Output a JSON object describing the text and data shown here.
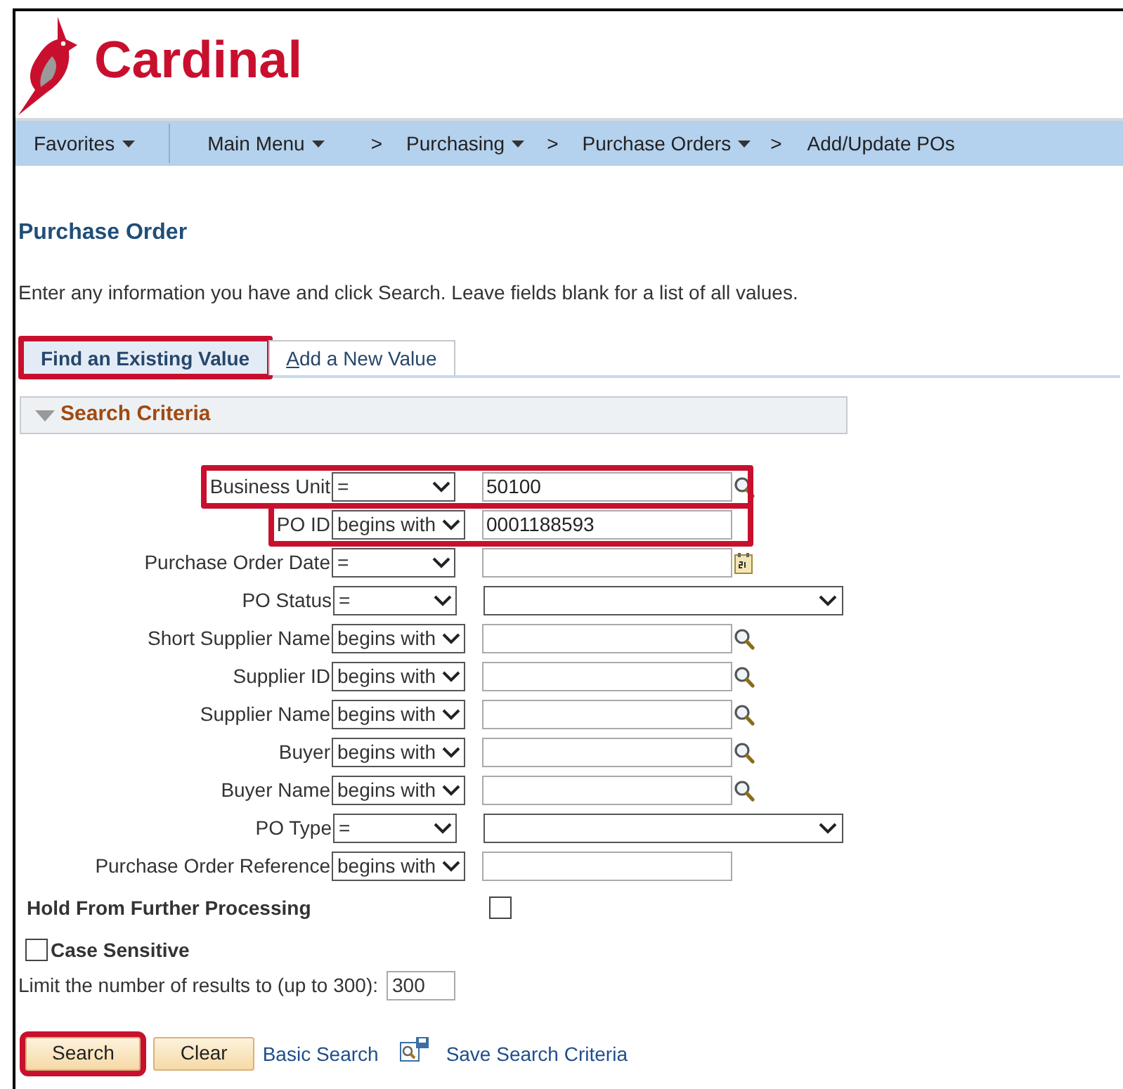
{
  "logo": {
    "text": "Cardinal"
  },
  "nav": [
    {
      "kind": "menu",
      "label": "Favorites",
      "caret": true
    },
    {
      "kind": "menu",
      "label": "Main Menu",
      "caret": true
    },
    {
      "kind": "separator",
      "label": ">"
    },
    {
      "kind": "menu",
      "label": "Purchasing",
      "caret": true
    },
    {
      "kind": "separator",
      "label": ">"
    },
    {
      "kind": "menu",
      "label": "Purchase Orders",
      "caret": true
    },
    {
      "kind": "separator",
      "label": ">"
    },
    {
      "kind": "menu",
      "label": "Add/Update POs",
      "caret": false
    }
  ],
  "page_title": "Purchase Order",
  "instructions": "Enter any information you have and click Search. Leave fields blank for a list of all values.",
  "tabs": [
    {
      "label": "Find an Existing Value",
      "selected": true,
      "highlighted": true,
      "access_key": false
    },
    {
      "label": "Add a New Value",
      "selected": false,
      "highlighted": false,
      "access_key": true
    }
  ],
  "section": {
    "title": "Search Criteria",
    "expanded": true
  },
  "fields": [
    {
      "label": "Business Unit",
      "kind": "lookup",
      "operator": "=",
      "value": "50100",
      "highlighted": true
    },
    {
      "label": "PO ID",
      "kind": "text",
      "operator": "begins with",
      "value": "0001188593",
      "highlighted": true
    },
    {
      "label": "Purchase Order Date",
      "kind": "date",
      "operator": "=",
      "highlighted": false
    },
    {
      "label": "PO Status",
      "kind": "dropdown",
      "operator": "=",
      "highlighted": false
    },
    {
      "label": "Short Supplier Name",
      "kind": "lookup",
      "operator": "begins with",
      "highlighted": false
    },
    {
      "label": "Supplier ID",
      "kind": "lookup",
      "operator": "begins with",
      "highlighted": false
    },
    {
      "label": "Supplier Name",
      "kind": "lookup",
      "operator": "begins with",
      "highlighted": false
    },
    {
      "label": "Buyer",
      "kind": "lookup",
      "operator": "begins with",
      "highlighted": false
    },
    {
      "label": "Buyer Name",
      "kind": "lookup",
      "operator": "begins with",
      "highlighted": false
    },
    {
      "label": "PO Type",
      "kind": "dropdown",
      "operator": "=",
      "highlighted": false
    },
    {
      "label": "Purchase Order Reference",
      "kind": "text",
      "operator": "begins with",
      "highlighted": false
    }
  ],
  "hold": {
    "label": "Hold From Further Processing",
    "checked": false
  },
  "case_sensitive": {
    "label": "Case Sensitive",
    "checked": false
  },
  "limit": {
    "label": "Limit the number of results to (up to 300):",
    "value": "300"
  },
  "buttons": [
    {
      "label": "Search",
      "highlighted": true
    },
    {
      "label": "Clear",
      "highlighted": false
    }
  ],
  "links": [
    {
      "label": "Basic Search",
      "kind": "plain"
    },
    {
      "label": "Save Search Criteria",
      "kind": "with_icon"
    }
  ]
}
